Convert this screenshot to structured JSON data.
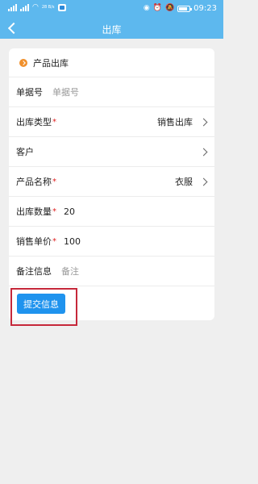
{
  "status_bar": {
    "network_speed": "28 B/s",
    "time": "09:23"
  },
  "nav": {
    "title": "出库"
  },
  "form": {
    "section_title": "产品出库",
    "order_no": {
      "label": "单据号",
      "placeholder": "单据号"
    },
    "outbound_type": {
      "label": "出库类型",
      "required": "*",
      "value": "销售出库"
    },
    "customer": {
      "label": "客户"
    },
    "product_name": {
      "label": "产品名称",
      "required": "*",
      "value": "衣服"
    },
    "quantity": {
      "label": "出库数量",
      "required": "*",
      "value": "20"
    },
    "unit_price": {
      "label": "销售单价",
      "required": "*",
      "value": "100"
    },
    "remark": {
      "label": "备注信息",
      "placeholder": "备注"
    },
    "submit_label": "提交信息"
  },
  "colors": {
    "header": "#5db8ee",
    "primary_button": "#1f93ee",
    "required_mark": "#e02020",
    "section_dot": "#f0902c",
    "annotation_box": "#c6283a"
  }
}
